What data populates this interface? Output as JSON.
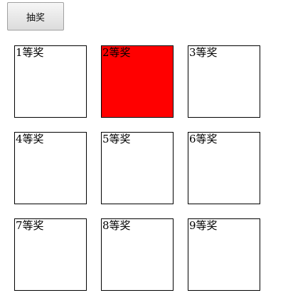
{
  "draw_button": {
    "label": "抽奖"
  },
  "highlight_color": "#ff0000",
  "prizes": [
    {
      "label": "1等奖",
      "active": false
    },
    {
      "label": "2等奖",
      "active": true
    },
    {
      "label": "3等奖",
      "active": false
    },
    {
      "label": "4等奖",
      "active": false
    },
    {
      "label": "5等奖",
      "active": false
    },
    {
      "label": "6等奖",
      "active": false
    },
    {
      "label": "7等奖",
      "active": false
    },
    {
      "label": "8等奖",
      "active": false
    },
    {
      "label": "9等奖",
      "active": false
    }
  ]
}
